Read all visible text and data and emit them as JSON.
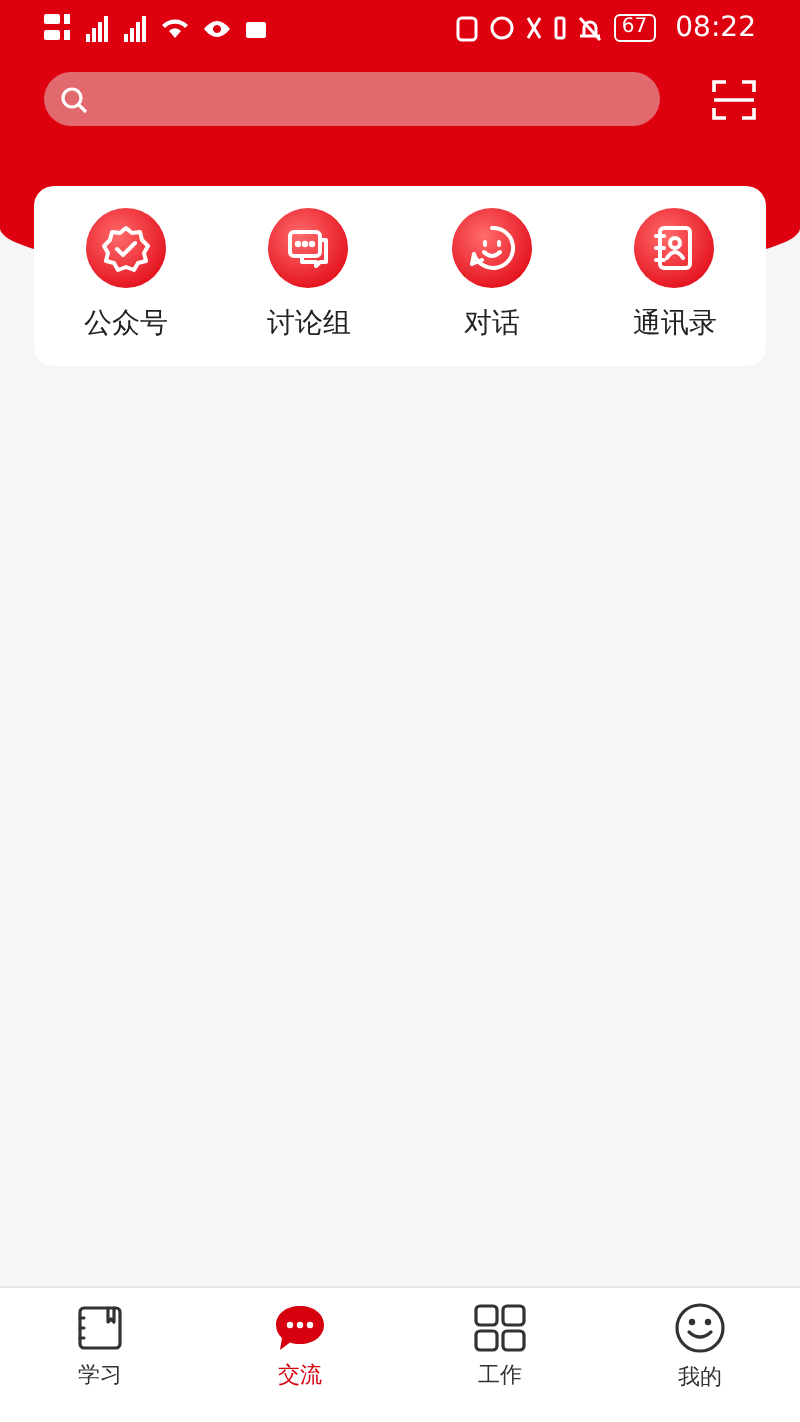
{
  "status_bar": {
    "battery": "67",
    "time": "08:22"
  },
  "shortcuts": [
    {
      "kind": "badge",
      "label": "公众号"
    },
    {
      "kind": "discussion",
      "label": "讨论组"
    },
    {
      "kind": "chat",
      "label": "对话"
    },
    {
      "kind": "contacts",
      "label": "通讯录"
    }
  ],
  "tab_bar": [
    {
      "kind": "study",
      "label": "学习",
      "selected": false
    },
    {
      "kind": "exchange",
      "label": "交流",
      "selected": true
    },
    {
      "kind": "work",
      "label": "工作",
      "selected": false
    },
    {
      "kind": "mine",
      "label": "我的",
      "selected": false
    }
  ]
}
